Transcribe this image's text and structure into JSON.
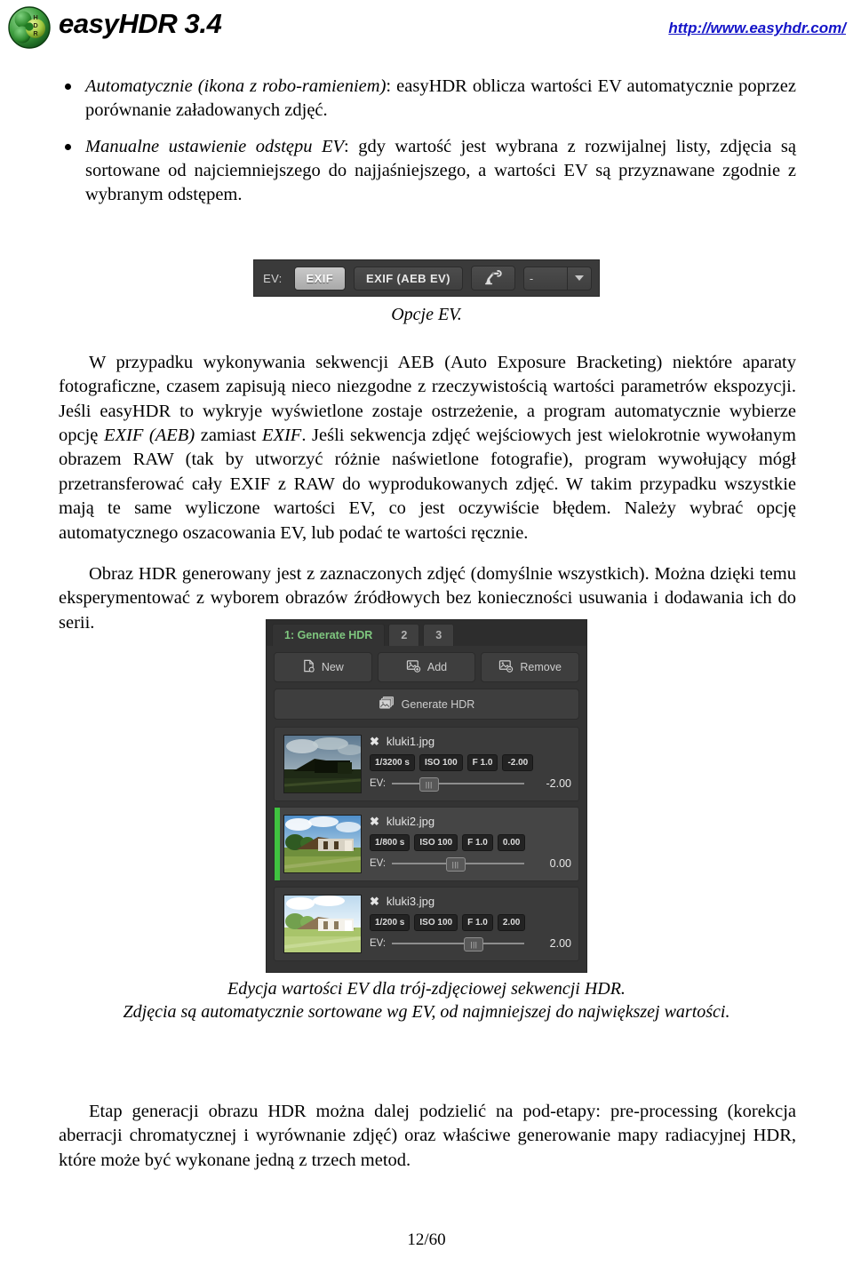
{
  "header": {
    "logo_icon": "easyhdr-logo-icon",
    "logo_letters": [
      "H",
      "D",
      "R"
    ],
    "brand_title": "easyHDR 3.4",
    "website_url": "http://www.easyhdr.com/"
  },
  "bullets": [
    {
      "emphasis": "Automatycznie (ikona z robo-ramieniem)",
      "rest": ": easyHDR oblicza wartości EV automatycznie poprzez porównanie załadowanych zdjęć."
    },
    {
      "emphasis": "Manualne ustawienie odstępu EV",
      "rest": ": gdy wartość jest wybrana z rozwijalnej listy, zdjęcia są sortowane od najciemniejszego do najjaśniejszego, a wartości EV są przyznawane zgodnie z wybranym odstępem."
    }
  ],
  "ev_toolbar": {
    "label": "EV:",
    "exif_button": "EXIF",
    "exif_aeb_button": "EXIF (AEB EV)",
    "robot_icon": "robot-arm-icon",
    "dropdown_value": "-",
    "dropdown_arrow_icon": "chevron-down-icon",
    "caption": "Opcje EV."
  },
  "paragraphs": {
    "aeb_warning": {
      "part1": "W przypadku wykonywania sekwencji AEB (Auto Exposure Bracketing) niektóre aparaty fotograficzne, czasem zapisują nieco niezgodne z rzeczywistością wartości parametrów ekspozycji. Jeśli easyHDR to wykryje wyświetlone zostaje ostrzeżenie, a program automatycznie wybierze opcję ",
      "em1": "EXIF (AEB)",
      "part2": " zamiast ",
      "em2": "EXIF",
      "part3": ". Jeśli sekwencja zdjęć wejściowych jest wielokrotnie wywołanym obrazem RAW (tak by utworzyć różnie naświetlone fotografie), program wywołujący mógł przetransferować cały EXIF z RAW do wyprodukowanych zdjęć. W takim przypadku wszystkie mają te same wyliczone wartości EV, co jest oczywiście błędem. Należy wybrać opcję automatycznego oszacowania EV, lub podać te wartości ręcznie."
    },
    "hdr_selection": "Obraz HDR generowany jest z zaznaczonych zdjęć (domyślnie wszystkich). Można dzięki temu eksperymentować z wyborem obrazów źródłowych bez konieczności usuwania i dodawania ich do serii.",
    "stage_split": "Etap generacji obrazu HDR można dalej podzielić na pod-etapy: pre-processing (korekcja aberracji chromatycznej i wyrównanie zdjęć) oraz właściwe generowanie mapy radiacyjnej HDR, które może być wykonane jedną z trzech metod."
  },
  "hdr_panel": {
    "tabs": [
      {
        "label": "1: Generate HDR",
        "active": true
      },
      {
        "label": "2",
        "active": false
      },
      {
        "label": "3",
        "active": false
      }
    ],
    "buttons": {
      "new": "New",
      "new_icon": "new-file-icon",
      "add": "Add",
      "add_icon": "add-image-icon",
      "remove": "Remove",
      "remove_icon": "remove-image-icon",
      "generate": "Generate HDR",
      "generate_icon": "stacked-images-icon"
    },
    "active_tab_color": "#7fc77f",
    "selected_marker_color": "#3fc23f",
    "images": [
      {
        "close_icon": "close-x-icon",
        "filename": "kluki1.jpg",
        "shutter": "1/3200 s",
        "iso": "ISO 100",
        "aperture": "F 1.0",
        "exposure_tag": "-2.00",
        "ev_label": "EV:",
        "ev_value": "-2.00",
        "slider_pct": 28,
        "selected": false,
        "thumb_brightness": 0.42
      },
      {
        "close_icon": "close-x-icon",
        "filename": "kluki2.jpg",
        "shutter": "1/800 s",
        "iso": "ISO 100",
        "aperture": "F 1.0",
        "exposure_tag": "0.00",
        "ev_label": "EV:",
        "ev_value": "0.00",
        "slider_pct": 48,
        "selected": true,
        "thumb_brightness": 1.0
      },
      {
        "close_icon": "close-x-icon",
        "filename": "kluki3.jpg",
        "shutter": "1/200 s",
        "iso": "ISO 100",
        "aperture": "F 1.0",
        "exposure_tag": "2.00",
        "ev_label": "EV:",
        "ev_value": "2.00",
        "slider_pct": 62,
        "selected": false,
        "thumb_brightness": 1.45
      }
    ],
    "caption_line1": "Edycja wartości EV dla trój-zdjęciowej sekwencji HDR.",
    "caption_line2": "Zdjęcia są automatycznie sortowane wg EV, od najmniejszej do największej wartości."
  },
  "footer": {
    "page_number": "12/60"
  }
}
